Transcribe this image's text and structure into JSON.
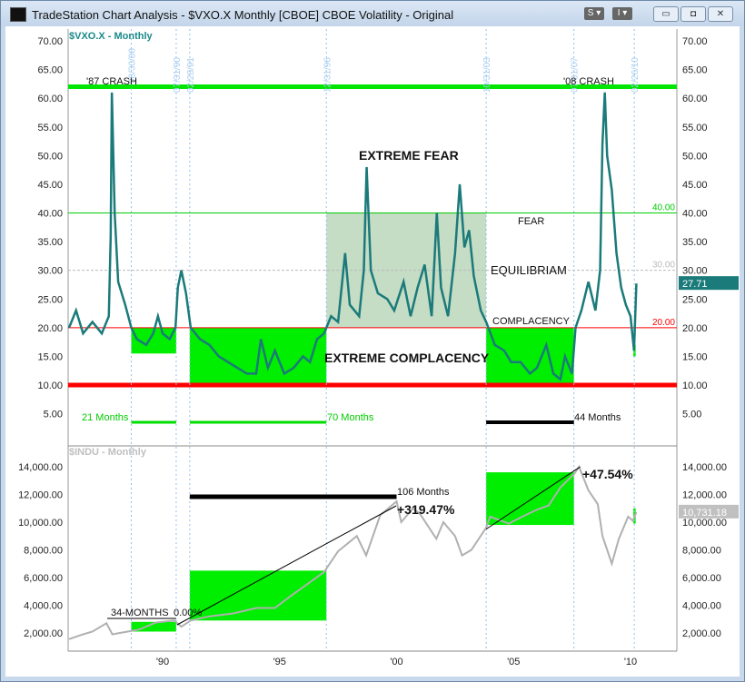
{
  "window": {
    "title": "TradeStation Chart Analysis - $VXO.X Monthly [CBOE] CBOE Volatility - Original",
    "btn_s": "S ▾",
    "btn_i": "I ▾",
    "min": "▭",
    "max": "◘",
    "close": "✕"
  },
  "chart_data": [
    {
      "type": "line",
      "title": "$VXO.X - Monthly",
      "ylim": [
        0,
        70
      ],
      "yticks": [
        "70.00",
        "65.00",
        "60.00",
        "55.00",
        "50.00",
        "45.00",
        "40.00",
        "35.00",
        "30.00",
        "25.00",
        "20.00",
        "15.00",
        "10.00",
        "5.00"
      ],
      "last_value": "27.71",
      "series": [
        {
          "name": "$VXO.X",
          "points": [
            [
              1986.0,
              20
            ],
            [
              1986.3,
              23
            ],
            [
              1986.6,
              19
            ],
            [
              1987.0,
              21
            ],
            [
              1987.4,
              19
            ],
            [
              1987.7,
              22
            ],
            [
              1987.78,
              36
            ],
            [
              1987.83,
              61
            ],
            [
              1987.95,
              40
            ],
            [
              1988.1,
              28
            ],
            [
              1988.4,
              24
            ],
            [
              1988.66,
              20
            ],
            [
              1988.9,
              18
            ],
            [
              1989.3,
              17
            ],
            [
              1989.6,
              19
            ],
            [
              1989.8,
              22
            ],
            [
              1990.0,
              19
            ],
            [
              1990.3,
              18
            ],
            [
              1990.55,
              20
            ],
            [
              1990.65,
              27
            ],
            [
              1990.8,
              30
            ],
            [
              1991.0,
              26
            ],
            [
              1991.2,
              20
            ],
            [
              1991.6,
              18
            ],
            [
              1992.0,
              17
            ],
            [
              1992.4,
              15
            ],
            [
              1992.8,
              14
            ],
            [
              1993.2,
              13
            ],
            [
              1993.6,
              12
            ],
            [
              1994.0,
              12
            ],
            [
              1994.2,
              18
            ],
            [
              1994.5,
              13
            ],
            [
              1994.8,
              16
            ],
            [
              1995.2,
              12
            ],
            [
              1995.6,
              13
            ],
            [
              1996.0,
              15
            ],
            [
              1996.3,
              14
            ],
            [
              1996.6,
              18
            ],
            [
              1996.9,
              19
            ],
            [
              1997.2,
              22
            ],
            [
              1997.5,
              21
            ],
            [
              1997.8,
              33
            ],
            [
              1998.0,
              24
            ],
            [
              1998.4,
              22
            ],
            [
              1998.6,
              30
            ],
            [
              1998.72,
              48
            ],
            [
              1998.9,
              30
            ],
            [
              1999.2,
              26
            ],
            [
              1999.6,
              25
            ],
            [
              1999.9,
              23
            ],
            [
              2000.3,
              28
            ],
            [
              2000.6,
              22
            ],
            [
              2000.9,
              27
            ],
            [
              2001.2,
              31
            ],
            [
              2001.5,
              22
            ],
            [
              2001.72,
              40
            ],
            [
              2001.9,
              27
            ],
            [
              2002.2,
              22
            ],
            [
              2002.5,
              33
            ],
            [
              2002.7,
              45
            ],
            [
              2002.9,
              34
            ],
            [
              2003.1,
              37
            ],
            [
              2003.3,
              29
            ],
            [
              2003.6,
              23
            ],
            [
              2003.83,
              21
            ],
            [
              2004.2,
              17
            ],
            [
              2004.6,
              16
            ],
            [
              2004.9,
              14
            ],
            [
              2005.3,
              14
            ],
            [
              2005.7,
              12
            ],
            [
              2006.0,
              13
            ],
            [
              2006.4,
              17
            ],
            [
              2006.7,
              12
            ],
            [
              2007.0,
              11
            ],
            [
              2007.2,
              15
            ],
            [
              2007.5,
              12
            ],
            [
              2007.65,
              20
            ],
            [
              2007.9,
              23
            ],
            [
              2008.2,
              28
            ],
            [
              2008.5,
              23
            ],
            [
              2008.7,
              30
            ],
            [
              2008.8,
              52
            ],
            [
              2008.9,
              61
            ],
            [
              2009.0,
              50
            ],
            [
              2009.2,
              44
            ],
            [
              2009.4,
              33
            ],
            [
              2009.6,
              27
            ],
            [
              2009.8,
              24
            ],
            [
              2010.0,
              22
            ],
            [
              2010.15,
              16
            ],
            [
              2010.25,
              27.71
            ]
          ]
        }
      ],
      "hlines": [
        {
          "value": 62,
          "color": "#00e600"
        },
        {
          "value": 40,
          "color": "#00cc00",
          "label": "40.00"
        },
        {
          "value": 30,
          "color": "#bbbbbb",
          "label": "30.00"
        },
        {
          "value": 20,
          "color": "#ff0000",
          "label": "20.00"
        },
        {
          "value": 10,
          "color": "#ff0000"
        }
      ],
      "vlines": [
        {
          "x": 1988.66,
          "label": "08/30/88"
        },
        {
          "x": 1990.58,
          "label": "07/31/90"
        },
        {
          "x": 1991.16,
          "label": "02/28/91"
        },
        {
          "x": 1997.0,
          "label": "12/31/96"
        },
        {
          "x": 2003.83,
          "label": "10/31/03"
        },
        {
          "x": 2007.58,
          "label": "07/31/07"
        },
        {
          "x": 2010.16,
          "label": "02/26/10"
        }
      ],
      "annotations": {
        "crash87": "'87 CRASH",
        "crash08": "'08 CRASH",
        "extreme_fear": "EXTREME FEAR",
        "fear": "FEAR",
        "equilibrium": "EQUILIBRIAM",
        "complacency": "COMPLACENCY",
        "extreme_complacency": "EXTREME COMPLACENCY",
        "m21": "21 Months",
        "m70": "70 Months",
        "m44": "44 Months"
      }
    },
    {
      "type": "line",
      "title": "$INDU - Monthly",
      "ylim": [
        1000,
        15000
      ],
      "yticks": [
        "14,000.00",
        "12,000.00",
        "10,000.00",
        "8,000.00",
        "6,000.00",
        "4,000.00",
        "2,000.00"
      ],
      "last_value": "10,731.18",
      "series": [
        {
          "name": "$INDU",
          "points": [
            [
              1986.0,
              1550
            ],
            [
              1986.5,
              1850
            ],
            [
              1987.0,
              2100
            ],
            [
              1987.6,
              2700
            ],
            [
              1987.85,
              1900
            ],
            [
              1988.5,
              2100
            ],
            [
              1989.0,
              2250
            ],
            [
              1989.7,
              2750
            ],
            [
              1990.5,
              2900
            ],
            [
              1990.8,
              2450
            ],
            [
              1991.2,
              2900
            ],
            [
              1992.0,
              3200
            ],
            [
              1993.0,
              3400
            ],
            [
              1994.0,
              3800
            ],
            [
              1994.8,
              3800
            ],
            [
              1995.5,
              4700
            ],
            [
              1996.0,
              5300
            ],
            [
              1996.9,
              6400
            ],
            [
              1997.5,
              7900
            ],
            [
              1998.3,
              9000
            ],
            [
              1998.7,
              7600
            ],
            [
              1999.3,
              10500
            ],
            [
              2000.0,
              11500
            ],
            [
              2000.2,
              10000
            ],
            [
              2000.7,
              11000
            ],
            [
              2001.0,
              10600
            ],
            [
              2001.7,
              8800
            ],
            [
              2002.0,
              10000
            ],
            [
              2002.5,
              9000
            ],
            [
              2002.8,
              7600
            ],
            [
              2003.2,
              8000
            ],
            [
              2003.83,
              9600
            ],
            [
              2004.0,
              10400
            ],
            [
              2004.8,
              9900
            ],
            [
              2005.5,
              10500
            ],
            [
              2006.0,
              10900
            ],
            [
              2006.5,
              11200
            ],
            [
              2007.0,
              12500
            ],
            [
              2007.6,
              13500
            ],
            [
              2007.8,
              14000
            ],
            [
              2008.2,
              12300
            ],
            [
              2008.6,
              11300
            ],
            [
              2008.8,
              9000
            ],
            [
              2009.2,
              7000
            ],
            [
              2009.5,
              8800
            ],
            [
              2009.9,
              10400
            ],
            [
              2010.1,
              10100
            ],
            [
              2010.25,
              10731
            ]
          ]
        }
      ],
      "annotations": {
        "m34": "34-MONTHS",
        "p0": "0.00%",
        "m106": "106 Months",
        "p319": "+319.47%",
        "p47": "+47.54%"
      }
    }
  ],
  "xaxis": {
    "ticks": [
      {
        "x": 1990,
        "label": "'90"
      },
      {
        "x": 1995,
        "label": "'95"
      },
      {
        "x": 2000,
        "label": "'00"
      },
      {
        "x": 2005,
        "label": "'05"
      },
      {
        "x": 2010,
        "label": "'10"
      }
    ]
  }
}
